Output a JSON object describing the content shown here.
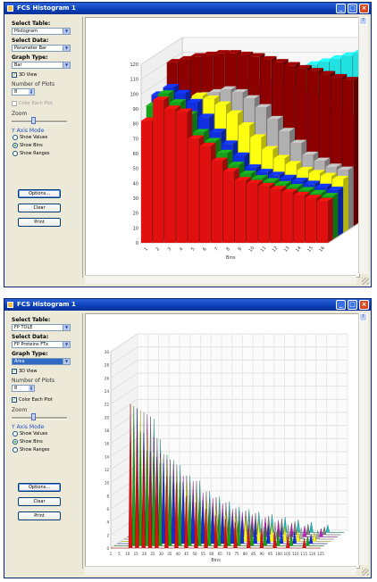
{
  "colors": {
    "accent": "#0a246a",
    "titlebar": "#2a62d9",
    "close": "#d8481e"
  },
  "top": {
    "window": {
      "title": "FCS Histogram 1",
      "help_icon": "?",
      "minimize_icon": "minimize-icon",
      "maximize_icon": "maximize-icon",
      "close_icon": "close-icon"
    },
    "controls": {
      "select_table_label": "Select Table:",
      "select_table_value": "Histogram",
      "select_data_label": "Select Data:",
      "select_data_value": "Parameter Bar",
      "graph_type_label": "Graph Type:",
      "graph_type_value": "Bar",
      "view_3d_label": "3D View",
      "view_3d_checked": true,
      "num_plots_label": "Number of Plots",
      "num_plots_value": "8",
      "color_each_plot_label": "Color Each Plot",
      "color_each_plot_checked": false,
      "zoom_label": "Zoom",
      "zoom_min": "1",
      "zoom_value": "10",
      "y_axis_mode_label": "Y Axis Mode",
      "radio_show_values": "Show Values",
      "radio_show_bins": "Show Bins",
      "radio_show_ranges": "Show Ranges",
      "radio_selected": "Show Bins",
      "options_button": "Options...",
      "clear_button": "Clear",
      "print_button": "Print"
    },
    "chart_data": {
      "type": "bar",
      "title": "",
      "xlabel": "Bins",
      "ylabel": "",
      "ylim": [
        0,
        120
      ],
      "yticks": [
        "0",
        "10",
        "20",
        "30",
        "40",
        "50",
        "60",
        "70",
        "80",
        "90",
        "100",
        "110",
        "120"
      ],
      "categories": [
        "1",
        "2",
        "3",
        "4",
        "5",
        "6",
        "7",
        "8",
        "9",
        "10",
        "11",
        "12",
        "13",
        "14",
        "15",
        "16"
      ],
      "series": [
        {
          "color": "#e01010",
          "values": [
            82,
            96,
            90,
            88,
            70,
            65,
            55,
            48,
            42,
            40,
            38,
            36,
            34,
            32,
            30,
            28
          ]
        },
        {
          "color": "#18a018",
          "values": [
            90,
            98,
            92,
            84,
            72,
            66,
            58,
            50,
            44,
            41,
            39,
            37,
            35,
            33,
            31,
            29
          ]
        },
        {
          "color": "#1030e0",
          "values": [
            95,
            100,
            96,
            90,
            80,
            70,
            62,
            54,
            46,
            43,
            41,
            39,
            37,
            35,
            33,
            31
          ]
        },
        {
          "color": "#ffff10",
          "values": [
            80,
            84,
            88,
            92,
            90,
            86,
            80,
            72,
            64,
            56,
            50,
            46,
            42,
            40,
            38,
            36
          ]
        },
        {
          "color": "#b0b0b0",
          "values": [
            76,
            82,
            86,
            90,
            92,
            94,
            92,
            88,
            82,
            74,
            66,
            58,
            50,
            46,
            42,
            40
          ]
        },
        {
          "color": "#8c0000",
          "values": [
            110,
            112,
            114,
            115,
            116,
            116,
            115,
            114,
            112,
            110,
            108,
            106,
            104,
            102,
            100,
            98
          ]
        },
        {
          "color": "#c020c0",
          "values": [
            70,
            74,
            78,
            82,
            86,
            90,
            92,
            94,
            94,
            92,
            90,
            86,
            82,
            78,
            74,
            70
          ]
        },
        {
          "color": "#20e0e0",
          "values": [
            60,
            64,
            68,
            72,
            76,
            80,
            84,
            88,
            92,
            96,
            100,
            104,
            106,
            108,
            110,
            112
          ]
        }
      ],
      "grid": true,
      "legend": "none"
    }
  },
  "bottom": {
    "window": {
      "title": "FCS Histogram 1",
      "help_icon": "?",
      "minimize_icon": "minimize-icon",
      "maximize_icon": "maximize-icon",
      "close_icon": "close-icon"
    },
    "controls": {
      "select_table_label": "Select Table:",
      "select_table_value": "FP TOLE",
      "select_data_label": "Select Data:",
      "select_data_value": "FP Proteins FTx",
      "graph_type_label": "Graph Type:",
      "graph_type_value": "Area",
      "view_3d_label": "3D View",
      "view_3d_checked": true,
      "num_plots_label": "Number of Plots",
      "num_plots_value": "8",
      "color_each_plot_label": "Color Each Plot",
      "color_each_plot_checked": true,
      "zoom_label": "Zoom",
      "zoom_min": "1",
      "zoom_value": "10",
      "y_axis_mode_label": "Y Axis Mode",
      "radio_show_values": "Show Values",
      "radio_show_bins": "Show Bins",
      "radio_show_ranges": "Show Ranges",
      "radio_selected": "Show Bins",
      "options_button": "Options...",
      "clear_button": "Clear",
      "print_button": "Print"
    },
    "chart_data": {
      "type": "area",
      "title": "",
      "xlabel": "Bins",
      "ylabel": "",
      "ylim": [
        0,
        30
      ],
      "yticks": [
        "0",
        "2",
        "4",
        "6",
        "8",
        "10",
        "12",
        "14",
        "16",
        "18",
        "20",
        "22",
        "24",
        "26",
        "28",
        "30"
      ],
      "xticks": [
        "1",
        "5",
        "10",
        "15",
        "20",
        "25",
        "30",
        "35",
        "40",
        "45",
        "50",
        "55",
        "60",
        "65",
        "70",
        "75",
        "80",
        "85",
        "90",
        "95",
        "100",
        "105",
        "110",
        "115",
        "120",
        "125"
      ],
      "peaks_x": [
        12,
        16,
        20,
        24,
        28,
        34,
        40,
        46,
        52,
        58,
        64,
        70,
        76,
        84,
        92,
        100,
        108,
        118
      ],
      "peaks_y": [
        22,
        18,
        15,
        14,
        13,
        11,
        10,
        8,
        7,
        6,
        5,
        4.5,
        4,
        3.5,
        3,
        2.5,
        2,
        1.5
      ],
      "series_colors": [
        "#e01010",
        "#18a018",
        "#1030e0",
        "#ffff10",
        "#b0b0b0",
        "#c020c0",
        "#808080",
        "#20c0c0"
      ],
      "grid": true,
      "legend": "none"
    }
  }
}
